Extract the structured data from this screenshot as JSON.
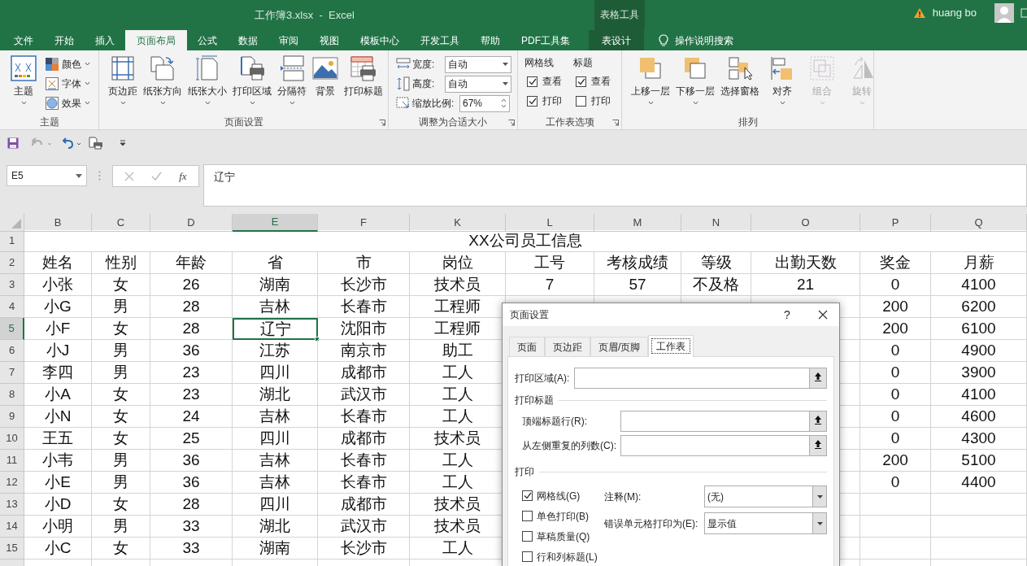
{
  "title_bar": {
    "document_title": "工作簿3.xlsx  -  Excel",
    "context_group": "表格工具",
    "user_name": "huang bo"
  },
  "ribbon_tabs": [
    {
      "label": "文件",
      "selected": false,
      "kind": "normal"
    },
    {
      "label": "开始",
      "selected": false,
      "kind": "normal"
    },
    {
      "label": "插入",
      "selected": false,
      "kind": "normal"
    },
    {
      "label": "页面布局",
      "selected": true,
      "kind": "normal"
    },
    {
      "label": "公式",
      "selected": false,
      "kind": "normal"
    },
    {
      "label": "数据",
      "selected": false,
      "kind": "normal"
    },
    {
      "label": "审阅",
      "selected": false,
      "kind": "normal"
    },
    {
      "label": "视图",
      "selected": false,
      "kind": "normal"
    },
    {
      "label": "模板中心",
      "selected": false,
      "kind": "normal"
    },
    {
      "label": "开发工具",
      "selected": false,
      "kind": "normal"
    },
    {
      "label": "帮助",
      "selected": false,
      "kind": "normal"
    },
    {
      "label": "PDF工具集",
      "selected": false,
      "kind": "normal"
    },
    {
      "label": "表设计",
      "selected": false,
      "kind": "context"
    }
  ],
  "tell_me": "操作说明搜索",
  "theme_group": {
    "label": "主题",
    "button": "主题",
    "items": [
      "颜色",
      "字体",
      "效果"
    ]
  },
  "page_setup_group": {
    "label": "页面设置",
    "buttons": [
      {
        "label": "页边距",
        "dropdown": true
      },
      {
        "label": "纸张方向",
        "dropdown": true
      },
      {
        "label": "纸张大小",
        "dropdown": true
      },
      {
        "label": "打印区域",
        "dropdown": true
      },
      {
        "label": "分隔符",
        "dropdown": true
      },
      {
        "label": "背景",
        "dropdown": false
      },
      {
        "label": "打印标题",
        "dropdown": false
      }
    ]
  },
  "scale_group": {
    "label": "调整为合适大小",
    "rows": [
      {
        "label": "宽度:",
        "value": "自动",
        "kind": "dropdown"
      },
      {
        "label": "高度:",
        "value": "自动",
        "kind": "dropdown"
      },
      {
        "label": "缩放比例:",
        "value": "67%",
        "kind": "spinner"
      }
    ]
  },
  "sheet_options_group": {
    "label": "工作表选项",
    "columns": [
      {
        "title": "网格线",
        "options": [
          {
            "label": "查看",
            "checked": true
          },
          {
            "label": "打印",
            "checked": true
          }
        ]
      },
      {
        "title": "标题",
        "options": [
          {
            "label": "查看",
            "checked": true
          },
          {
            "label": "打印",
            "checked": false
          }
        ]
      }
    ]
  },
  "arrange_group": {
    "label": "排列",
    "buttons": [
      {
        "label": "上移一层",
        "disabled": false
      },
      {
        "label": "下移一层",
        "disabled": false
      },
      {
        "label": "选择窗格",
        "disabled": false
      },
      {
        "label": "对齐",
        "disabled": false
      },
      {
        "label": "组合",
        "disabled": true
      },
      {
        "label": "旋转",
        "disabled": true
      }
    ]
  },
  "formula_bar": {
    "name_box": "E5",
    "function_button": "fx",
    "content": "辽宁"
  },
  "sheet": {
    "columns": [
      {
        "label": "B",
        "selected": false
      },
      {
        "label": "C",
        "selected": false
      },
      {
        "label": "D",
        "selected": false
      },
      {
        "label": "E",
        "selected": true
      },
      {
        "label": "F",
        "selected": false
      },
      {
        "label": "K",
        "selected": false
      },
      {
        "label": "L",
        "selected": false
      },
      {
        "label": "M",
        "selected": false
      },
      {
        "label": "N",
        "selected": false
      },
      {
        "label": "O",
        "selected": false
      },
      {
        "label": "P",
        "selected": false
      },
      {
        "label": "Q",
        "selected": false
      }
    ],
    "title_row": {
      "number": "1",
      "text": "XX公司员工信息"
    },
    "rows": [
      {
        "number": "2",
        "selected": false,
        "cells": [
          "姓名",
          "性别",
          "年龄",
          "省",
          "市",
          "岗位",
          "工号",
          "考核成绩",
          "等级",
          "出勤天数",
          "奖金",
          "月薪"
        ]
      },
      {
        "number": "3",
        "selected": false,
        "cells": [
          "小张",
          "女",
          "26",
          "湖南",
          "长沙市",
          "技术员",
          "7",
          "57",
          "不及格",
          "21",
          "0",
          "4100"
        ]
      },
      {
        "number": "4",
        "selected": false,
        "cells": [
          "小G",
          "男",
          "28",
          "吉林",
          "长春市",
          "工程师",
          null,
          null,
          null,
          null,
          "200",
          "6200"
        ]
      },
      {
        "number": "5",
        "selected": true,
        "cells": [
          "小F",
          "女",
          "28",
          "辽宁",
          "沈阳市",
          "工程师",
          null,
          null,
          null,
          null,
          "200",
          "6100"
        ]
      },
      {
        "number": "6",
        "selected": false,
        "cells": [
          "小J",
          "男",
          "36",
          "江苏",
          "南京市",
          "助工",
          null,
          null,
          null,
          null,
          "0",
          "4900"
        ]
      },
      {
        "number": "7",
        "selected": false,
        "cells": [
          "李四",
          "男",
          "23",
          "四川",
          "成都市",
          "工人",
          null,
          null,
          null,
          null,
          "0",
          "3900"
        ]
      },
      {
        "number": "8",
        "selected": false,
        "cells": [
          "小A",
          "女",
          "23",
          "湖北",
          "武汉市",
          "工人",
          null,
          null,
          null,
          null,
          "0",
          "4100"
        ]
      },
      {
        "number": "9",
        "selected": false,
        "cells": [
          "小N",
          "女",
          "24",
          "吉林",
          "长春市",
          "工人",
          null,
          null,
          null,
          null,
          "0",
          "4600"
        ]
      },
      {
        "number": "10",
        "selected": false,
        "cells": [
          "王五",
          "女",
          "25",
          "四川",
          "成都市",
          "技术员",
          null,
          null,
          null,
          null,
          "0",
          "4300"
        ]
      },
      {
        "number": "11",
        "selected": false,
        "cells": [
          "小韦",
          "男",
          "36",
          "吉林",
          "长春市",
          "工人",
          null,
          null,
          null,
          null,
          "200",
          "5100"
        ]
      },
      {
        "number": "12",
        "selected": false,
        "cells": [
          "小E",
          "男",
          "36",
          "吉林",
          "长春市",
          "工人",
          null,
          null,
          null,
          null,
          "0",
          "4400"
        ]
      },
      {
        "number": "13",
        "selected": false,
        "cells": [
          "小D",
          "女",
          "28",
          "四川",
          "成都市",
          "技术员",
          null,
          null,
          null,
          null,
          null,
          null
        ]
      },
      {
        "number": "14",
        "selected": false,
        "cells": [
          "小明",
          "男",
          "33",
          "湖北",
          "武汉市",
          "技术员",
          null,
          null,
          null,
          null,
          null,
          null
        ]
      },
      {
        "number": "15",
        "selected": false,
        "cells": [
          "小C",
          "女",
          "33",
          "湖南",
          "长沙市",
          "工人",
          null,
          null,
          null,
          null,
          null,
          null
        ]
      }
    ]
  },
  "dialog": {
    "title": "页面设置",
    "help_glyph": "?",
    "tabs": [
      {
        "label": "页面",
        "selected": false
      },
      {
        "label": "页边距",
        "selected": false
      },
      {
        "label": "页眉/页脚",
        "selected": false
      },
      {
        "label": "工作表",
        "selected": true
      }
    ],
    "print_area_label": "打印区域(A):",
    "print_titles_heading": "打印标题",
    "rows_to_repeat_label": "顶端标题行(R):",
    "columns_to_repeat_label": "从左侧重复的列数(C):",
    "print_heading": "打印",
    "print_options": [
      {
        "label": "网格线(G)",
        "checked": true
      },
      {
        "label": "单色打印(B)",
        "checked": false
      },
      {
        "label": "草稿质量(Q)",
        "checked": false
      },
      {
        "label": "行和列标题(L)",
        "checked": false
      }
    ],
    "comments_label": "注释(M):",
    "comments_value": "(无)",
    "errors_label": "错误单元格打印为(E):",
    "errors_value": "显示值"
  }
}
